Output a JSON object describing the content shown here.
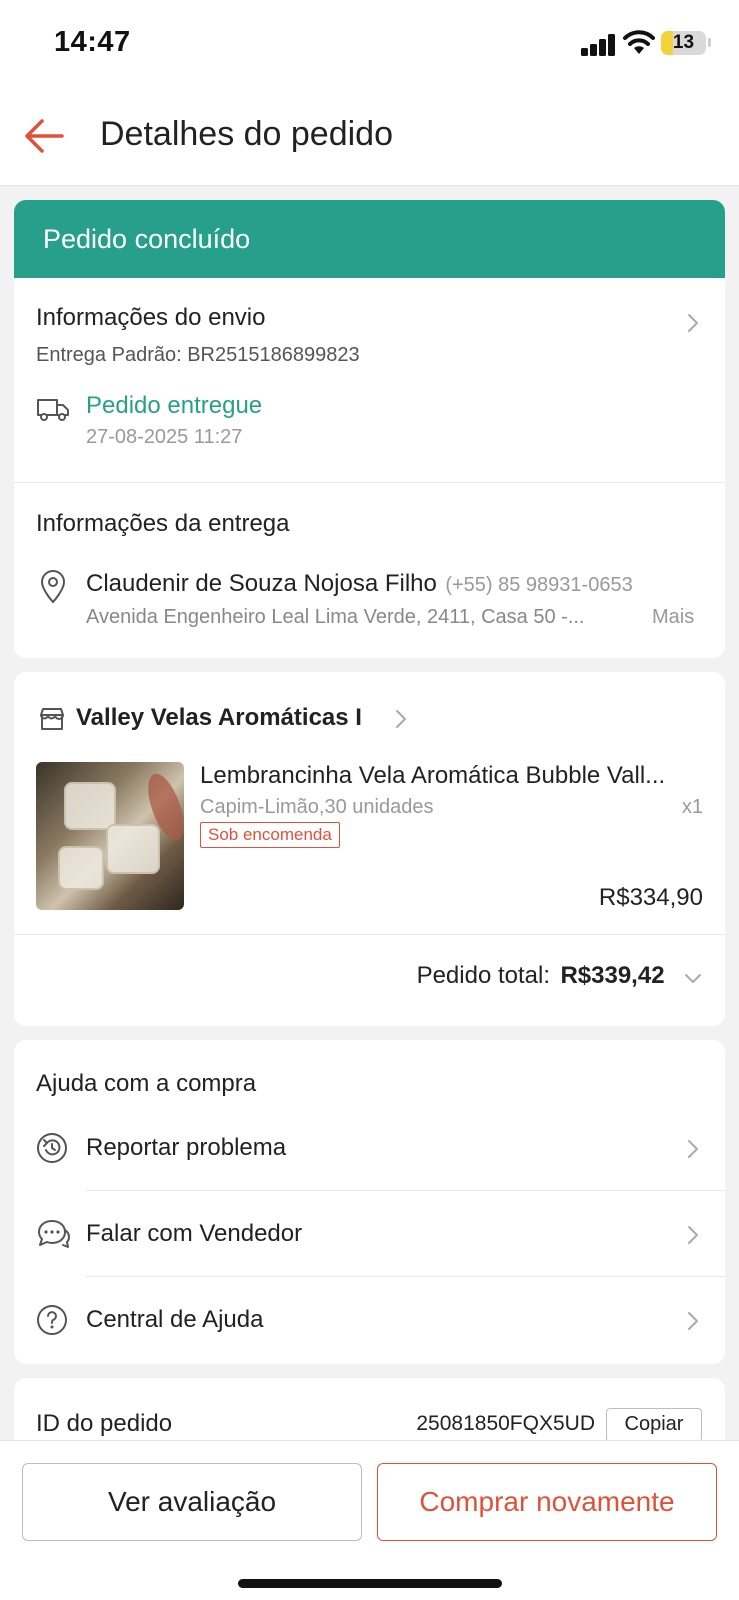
{
  "status_bar": {
    "time": "14:47",
    "battery": "13"
  },
  "header": {
    "title": "Detalhes do pedido"
  },
  "order_status": {
    "banner": "Pedido concluído"
  },
  "shipping": {
    "title": "Informações do envio",
    "tracking": "Entrega Padrão: BR2515186899823",
    "status": "Pedido entregue",
    "status_time": "27-08-2025 11:27"
  },
  "delivery": {
    "title": "Informações da entrega",
    "name": "Claudenir de Souza Nojosa Filho",
    "phone": "(+55) 85 98931-0653",
    "address": "Avenida Engenheiro Leal Lima Verde, 2411, Casa 50 -...",
    "more": "Mais"
  },
  "shop": {
    "name": "Valley Velas Aromáticas I",
    "product": {
      "title": "Lembrancinha Vela Aromática Bubble Vall...",
      "variant": "Capim-Limão,30 unidades",
      "qty": "x1",
      "tag": "Sob encomenda",
      "price": "R$334,90"
    },
    "total_label": "Pedido total:",
    "total_value": "R$339,42"
  },
  "help": {
    "title": "Ajuda com a compra",
    "items": [
      {
        "label": "Reportar problema",
        "icon": "report-icon"
      },
      {
        "label": "Falar com Vendedor",
        "icon": "chat-icon"
      },
      {
        "label": "Central de Ajuda",
        "icon": "help-icon"
      }
    ]
  },
  "order_id": {
    "label": "ID do pedido",
    "value": "25081850FQX5UD",
    "copy": "Copiar"
  },
  "actions": {
    "review": "Ver avaliação",
    "buy_again": "Comprar novamente"
  },
  "colors": {
    "accent_green": "#26a08a",
    "accent_orange": "#e0513a"
  }
}
